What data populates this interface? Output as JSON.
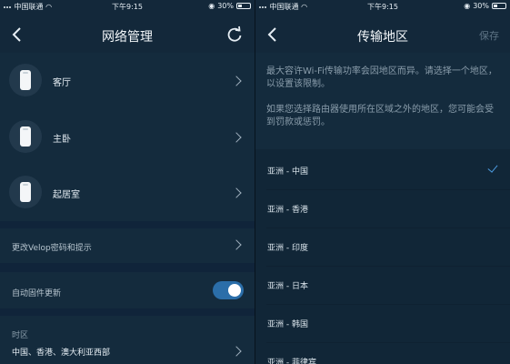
{
  "left": {
    "status": {
      "carrier": "中国联通",
      "time": "下午9:15",
      "battery": "30%"
    },
    "nav": {
      "title": "网络管理"
    },
    "devices": [
      {
        "label": "客厅"
      },
      {
        "label": "主卧"
      },
      {
        "label": "起居室"
      }
    ],
    "settings": {
      "change_password": "更改Velop密码和提示",
      "auto_update": "自动固件更新",
      "auto_update_on": true,
      "timezone_header": "时区",
      "timezone_value": "中国、香港、澳大利亚西部"
    }
  },
  "right": {
    "status": {
      "carrier": "中国联通",
      "time": "下午9:15",
      "battery": "30%"
    },
    "nav": {
      "title": "传输地区",
      "save_label": "保存"
    },
    "description1": "最大容许Wi-Fi传输功率会因地区而异。请选择一个地区，以设置该限制。",
    "description2": "如果您选择路由器使用所在区域之外的地区，您可能会受到罚款或惩罚。",
    "regions": [
      {
        "label": "亚洲 - 中国",
        "selected": true
      },
      {
        "label": "亚洲 - 香港",
        "selected": false
      },
      {
        "label": "亚洲 - 印度",
        "selected": false
      },
      {
        "label": "亚洲 - 日本",
        "selected": false
      },
      {
        "label": "亚洲 - 韩国",
        "selected": false
      },
      {
        "label": "亚洲 - 菲律宾",
        "selected": false
      }
    ]
  }
}
